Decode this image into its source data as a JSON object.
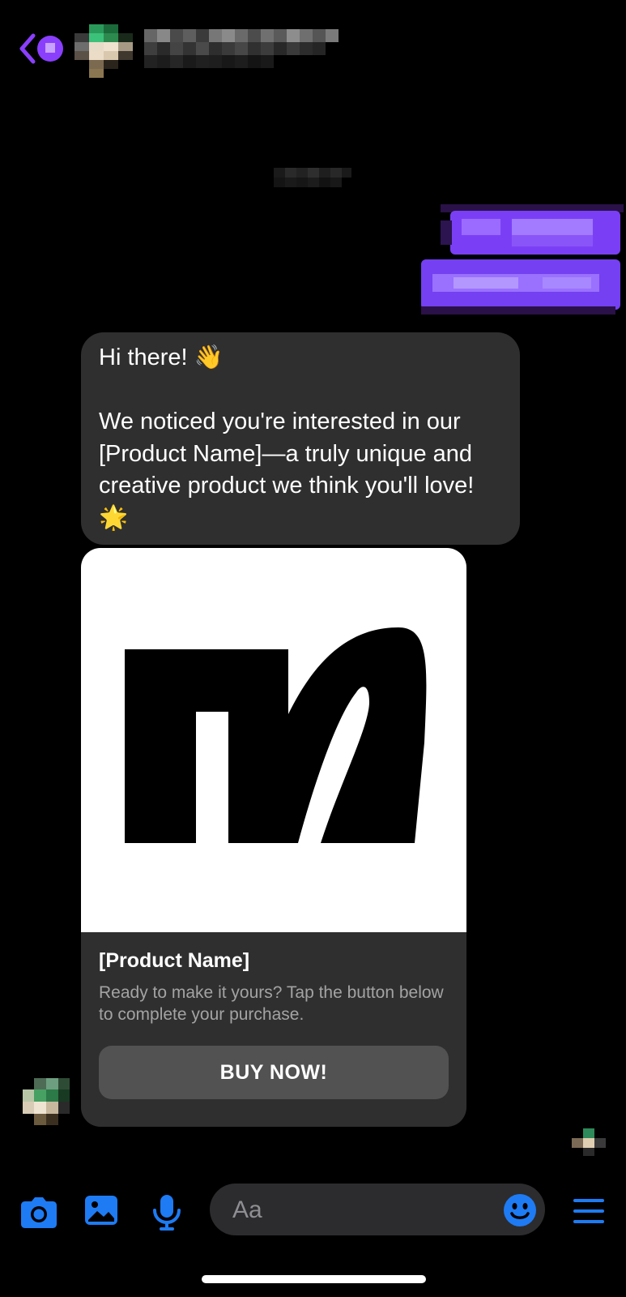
{
  "colors": {
    "accent_purple": "#8a3ffc",
    "bubble_gray": "#2f2f2f",
    "button_gray": "#525252",
    "icon_blue": "#1e7bf3"
  },
  "header": {
    "back_icon": "chevron-left-icon",
    "contact_name": "",
    "contact_name_pixelated": true
  },
  "thread": {
    "timestamp": "",
    "timestamp_pixelated": true,
    "outgoing_messages_pixelated": 2,
    "incoming_message": {
      "greeting": "Hi there! 👋",
      "body_lines": [
        "We noticed you're interested in our",
        "[Product Name]—a truly unique and",
        "creative product we think you'll love!",
        "🌟"
      ]
    },
    "product_card": {
      "image_icon": "brand-logo-m-icon",
      "title": "[Product Name]",
      "description": "Ready to make it yours? Tap the button below to complete your purchase.",
      "button_label": "BUY NOW!"
    }
  },
  "composer": {
    "placeholder": "Aa",
    "icons": [
      "camera-icon",
      "photo-icon",
      "microphone-icon",
      "emoji-icon",
      "menu-icon"
    ]
  }
}
